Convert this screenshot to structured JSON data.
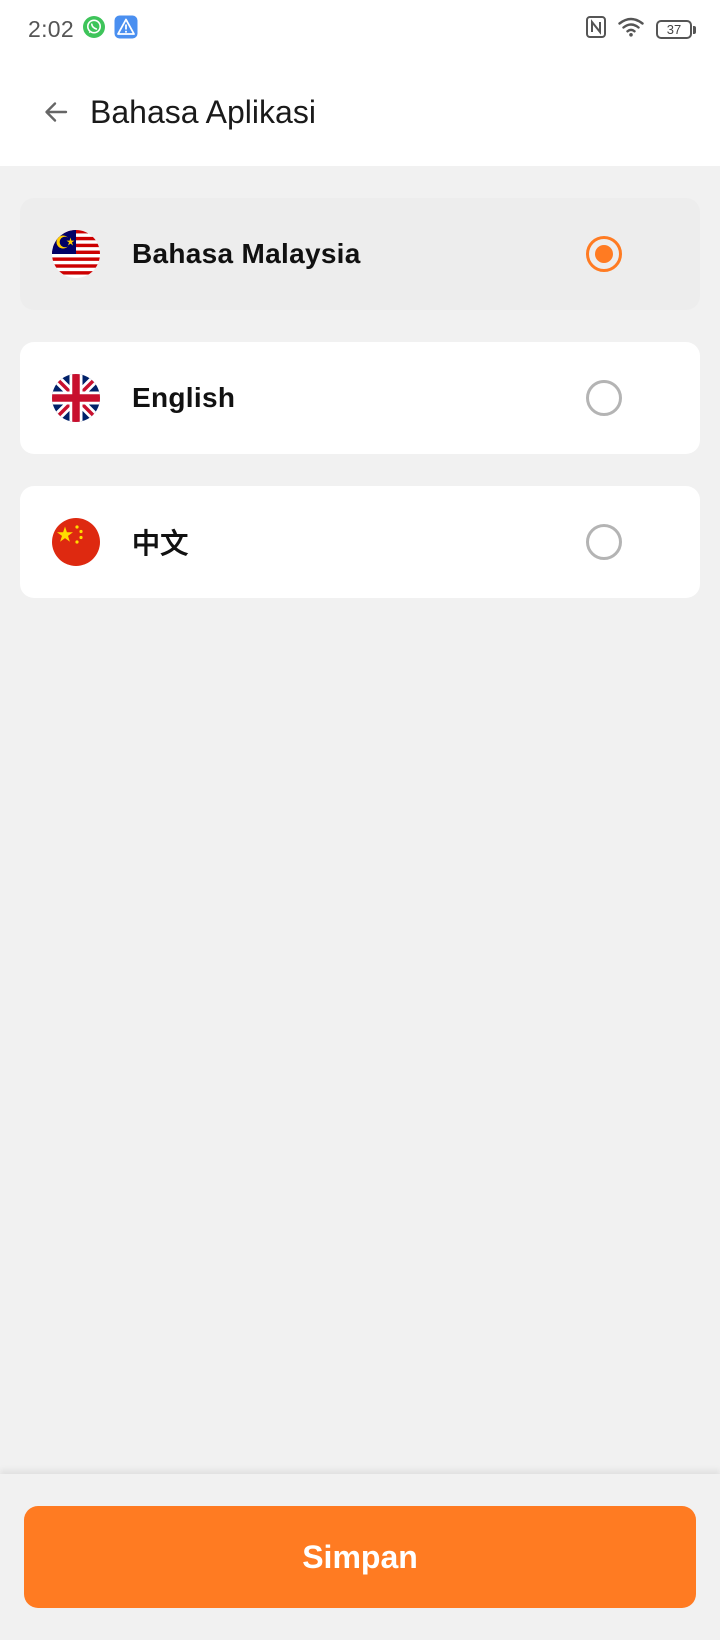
{
  "status_bar": {
    "time": "2:02",
    "battery": "37",
    "icons": [
      "whatsapp-icon",
      "alert-icon",
      "nfc-icon",
      "wifi-icon",
      "battery-icon"
    ]
  },
  "header": {
    "back_icon": "arrow-left-icon",
    "title": "Bahasa Aplikasi"
  },
  "languages": [
    {
      "label": "Bahasa Malaysia",
      "flag": "malaysia-flag-icon",
      "selected": true
    },
    {
      "label": "English",
      "flag": "uk-flag-icon",
      "selected": false
    },
    {
      "label": "中文",
      "flag": "china-flag-icon",
      "selected": false
    }
  ],
  "footer": {
    "save_label": "Simpan"
  },
  "colors": {
    "accent": "#ff7b22",
    "background": "#f1f1f1",
    "card": "#ffffff",
    "selected_card": "#ededed"
  }
}
